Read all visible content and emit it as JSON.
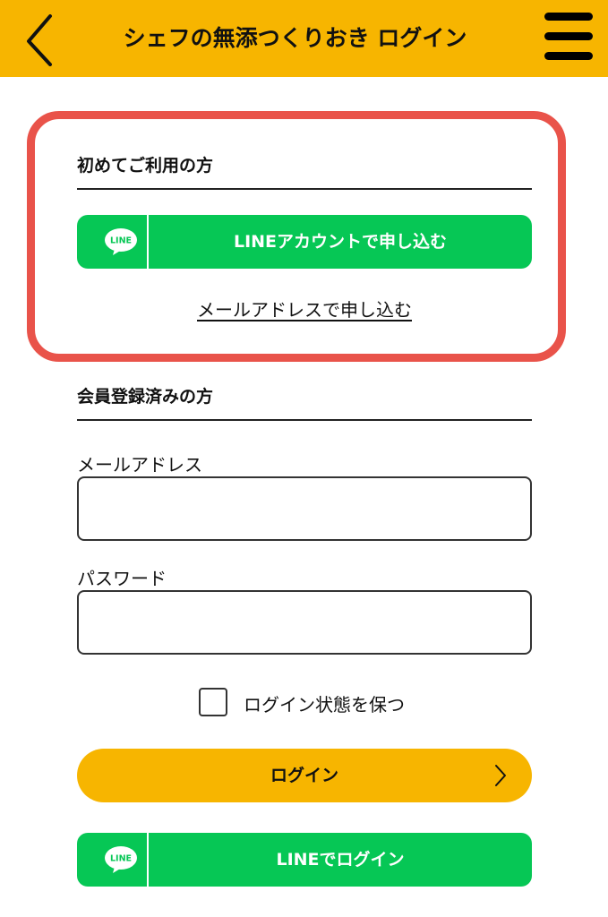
{
  "header": {
    "title": "シェフの無添つくりおき ログイン",
    "back_icon": "chevron-left-icon",
    "menu_icon": "hamburger-menu-icon",
    "background_color": "#f7b500"
  },
  "new_user": {
    "heading": "初めてご利用の方",
    "line_signup_label": "LINEアカウントで申し込む",
    "line_logo_text": "LINE",
    "email_signup_link": "メールアドレスで申し込む",
    "highlight_color": "#e9534a"
  },
  "member": {
    "heading": "会員登録済みの方",
    "email_label": "メールアドレス",
    "email_value": "",
    "password_label": "パスワード",
    "password_value": "",
    "remember_label": "ログイン状態を保つ",
    "remember_checked": false,
    "login_button_label": "ログイン",
    "login_button_icon": "chevron-right-icon",
    "line_login_label": "LINEでログイン",
    "line_logo_text": "LINE"
  },
  "colors": {
    "brand_yellow": "#f7b500",
    "line_green": "#06c755"
  }
}
